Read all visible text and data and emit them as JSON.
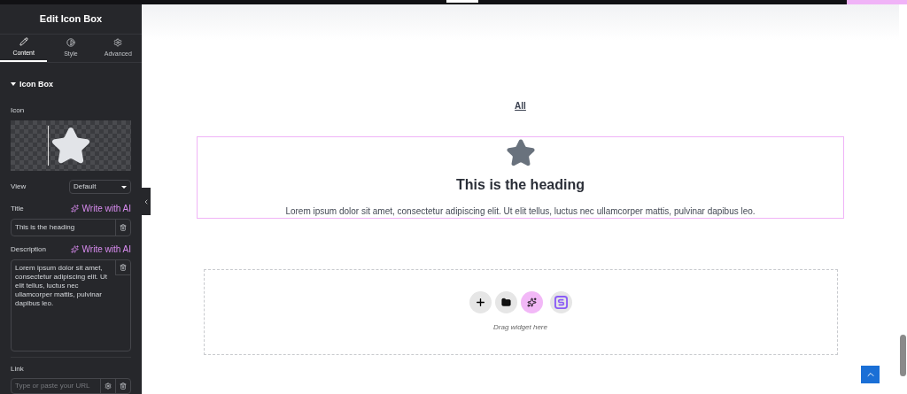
{
  "panel": {
    "title": "Edit Icon Box",
    "tabs": [
      {
        "label": "Content",
        "kind": "pencil",
        "selected": true
      },
      {
        "label": "Style",
        "kind": "contrast",
        "selected": false
      },
      {
        "label": "Advanced",
        "kind": "gear",
        "selected": false
      }
    ],
    "section": {
      "title": "Icon Box",
      "expanded": true
    },
    "icon_label": "Icon",
    "view": {
      "label": "View",
      "value": "Default"
    },
    "title_field": {
      "label": "Title",
      "ai": "Write with AI",
      "value": "This is the heading"
    },
    "description_field": {
      "label": "Description",
      "ai": "Write with AI",
      "value": "Lorem ipsum dolor sit amet, consectetur adipiscing elit. Ut elit tellus, luctus nec ullamcorper mattis, pulvinar dapibus leo."
    },
    "link_field": {
      "label": "Link",
      "placeholder": "Type or paste your URL"
    }
  },
  "canvas": {
    "link": "All",
    "icon_box": {
      "heading": "This is the heading",
      "description": "Lorem ipsum dolor sit amet, consectetur adipiscing elit. Ut elit tellus, luctus nec ullamcorper mattis, pulvinar dapibus leo."
    },
    "dropzone": {
      "hint": "Drag widget here",
      "buttons": [
        {
          "kind": "add"
        },
        {
          "kind": "folder"
        },
        {
          "kind": "ai"
        },
        {
          "kind": "logo"
        }
      ]
    }
  }
}
